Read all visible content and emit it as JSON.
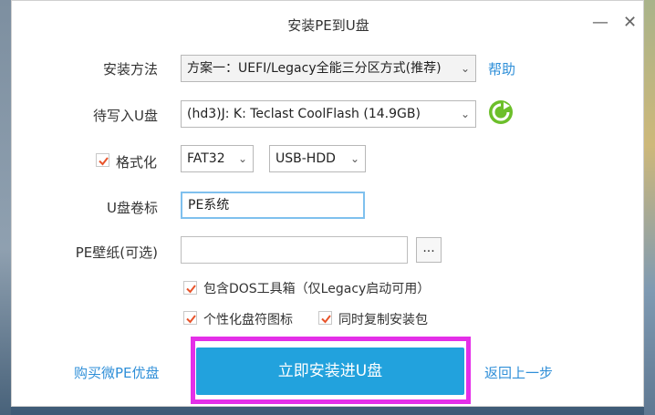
{
  "window": {
    "title": "安装PE到U盘",
    "minimize_symbol": "—",
    "close_symbol": "✕"
  },
  "form": {
    "install_method_label": "安装方法",
    "install_method_value": "方案一：UEFI/Legacy全能三分区方式(推荐)",
    "help_link": "帮助",
    "target_disk_label": "待写入U盘",
    "target_disk_value": "(hd3)J: K: Teclast CoolFlash (14.9GB)",
    "refresh_icon": "refresh-icon",
    "format_label": "格式化",
    "format_checked": true,
    "filesystem_value": "FAT32",
    "boot_mode_value": "USB-HDD",
    "volume_label_label": "U盘卷标",
    "volume_label_value": "PE系统",
    "wallpaper_label": "PE壁纸(可选)",
    "wallpaper_value": "",
    "browse_label": "...",
    "dos_tools_label": "包含DOS工具箱（仅Legacy启动可用）",
    "dos_tools_checked": true,
    "custom_icon_label": "个性化盘符图标",
    "custom_icon_checked": true,
    "copy_installer_label": "同时复制安装包",
    "copy_installer_checked": true
  },
  "footer": {
    "buy_link": "购买微PE优盘",
    "install_button": "立即安装进U盘",
    "back_link": "返回上一步"
  },
  "colors": {
    "accent": "#22a2dd",
    "link": "#2f8fd8",
    "highlight": "#e42fe8",
    "check": "#e8542b",
    "refresh": "#6cbf2a"
  }
}
